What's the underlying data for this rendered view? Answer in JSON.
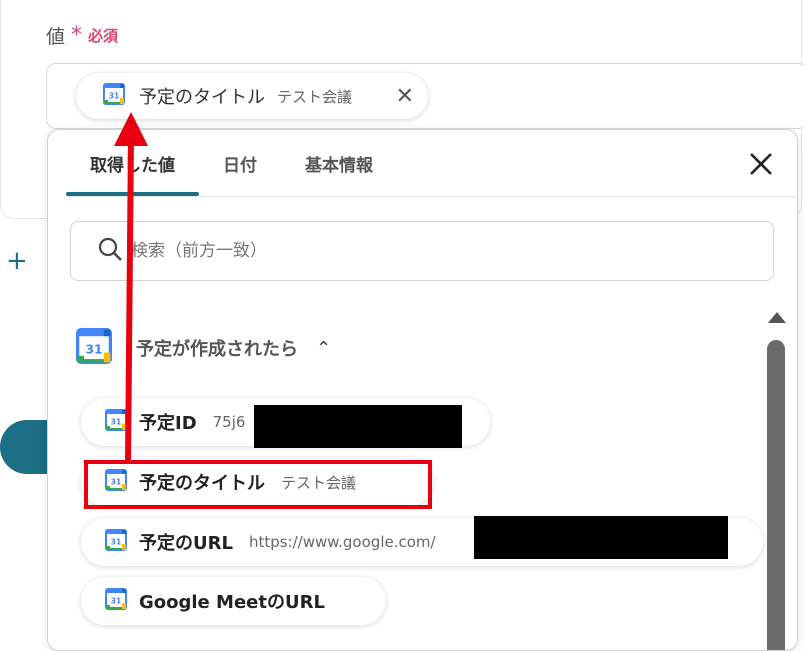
{
  "field": {
    "label": "値",
    "required_star": "*",
    "required_text": "必須"
  },
  "selected_chip": {
    "name": "予定のタイトル",
    "value": "テスト会議",
    "remove_icon": "close-icon",
    "remove_glyph": "✕"
  },
  "panel": {
    "tabs": [
      {
        "label": "取得した値",
        "active": true
      },
      {
        "label": "日付",
        "active": false
      },
      {
        "label": "基本情報",
        "active": false
      }
    ],
    "search_placeholder": "検索（前方一致）",
    "section": {
      "title": "予定が作成されたら",
      "toggle_glyph": "⌃"
    },
    "items": [
      {
        "name": "予定ID",
        "value": "75j6"
      },
      {
        "name": "予定のタイトル",
        "value": "テスト会議"
      },
      {
        "name": "予定のURL",
        "value": "https://www.google.com/"
      },
      {
        "name": "Google MeetのURL",
        "value": ""
      }
    ]
  },
  "plus_glyph": "+",
  "colors": {
    "accent": "#1c6f84",
    "required": "#e0436b",
    "annotation_red": "#e8000e"
  },
  "calendar_icon_text": "31"
}
